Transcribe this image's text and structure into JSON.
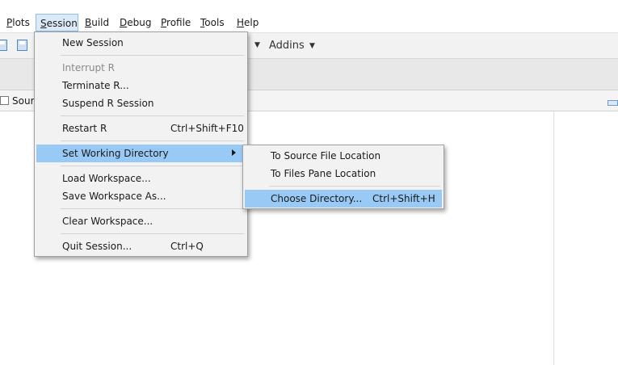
{
  "menubar": {
    "items": [
      {
        "label": "Plots",
        "mnemonic": "P"
      },
      {
        "label": "Session",
        "mnemonic": "S"
      },
      {
        "label": "Build",
        "mnemonic": "B"
      },
      {
        "label": "Debug",
        "mnemonic": "D"
      },
      {
        "label": "Profile",
        "mnemonic": "P"
      },
      {
        "label": "Tools",
        "mnemonic": "T"
      },
      {
        "label": "Help",
        "mnemonic": "H"
      }
    ]
  },
  "toolbar": {
    "addins_label": "Addins"
  },
  "source_pane": {
    "tab_label": "Sourc"
  },
  "session_menu": {
    "items": [
      {
        "label": "New Session",
        "shortcut": ""
      },
      {
        "label": "Interrupt R",
        "shortcut": "",
        "disabled": true
      },
      {
        "label": "Terminate R...",
        "shortcut": ""
      },
      {
        "label": "Suspend R Session",
        "shortcut": ""
      },
      {
        "label": "Restart R",
        "shortcut": "Ctrl+Shift+F10"
      },
      {
        "label": "Set Working Directory",
        "shortcut": "",
        "submenu": true
      },
      {
        "label": "Load Workspace...",
        "shortcut": ""
      },
      {
        "label": "Save Workspace As...",
        "shortcut": ""
      },
      {
        "label": "Clear Workspace...",
        "shortcut": ""
      },
      {
        "label": "Quit Session...",
        "shortcut": "Ctrl+Q"
      }
    ]
  },
  "working_dir_submenu": {
    "items": [
      {
        "label": "To Source File Location",
        "shortcut": ""
      },
      {
        "label": "To Files Pane Location",
        "shortcut": ""
      },
      {
        "label": "Choose Directory...",
        "shortcut": "Ctrl+Shift+H"
      }
    ]
  },
  "colors": {
    "highlight": "#99c9f5",
    "menu_bg": "#f2f2f2",
    "active_menubar": "#dbe9f8"
  }
}
